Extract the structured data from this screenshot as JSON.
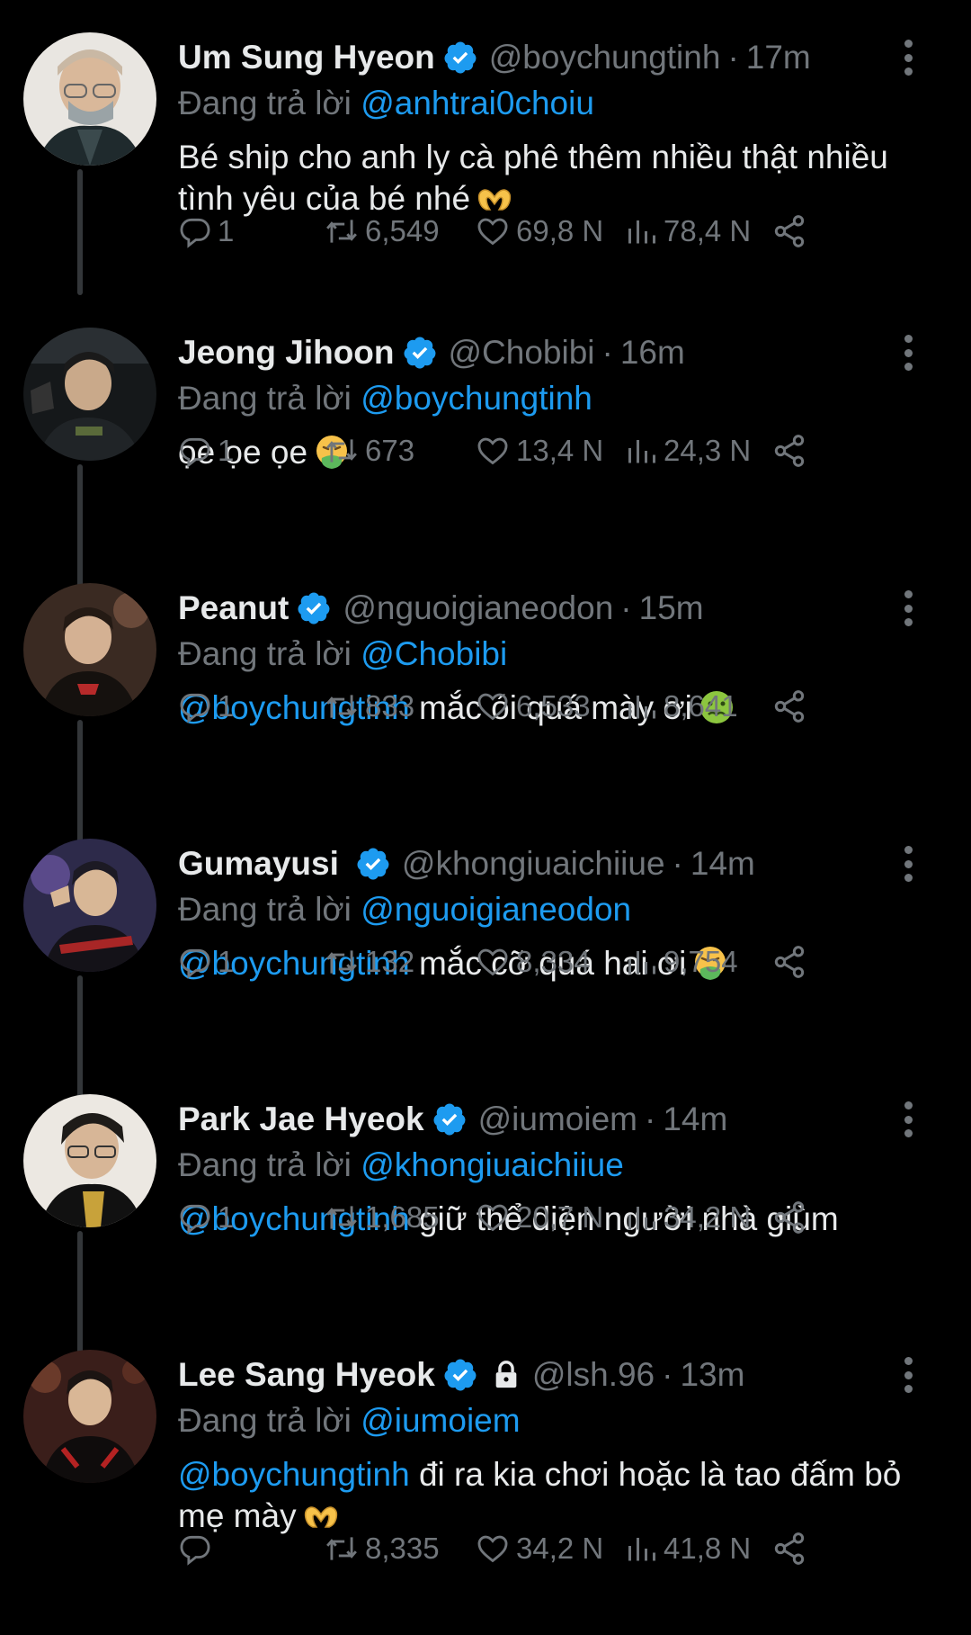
{
  "labels": {
    "replying_to": "Đang trả lời"
  },
  "colors": {
    "accent": "#1d9bf0",
    "muted": "#71767b",
    "background": "#000000"
  },
  "tweets": [
    {
      "name": "Um Sung Hyeon",
      "handle": "@boychungtinh",
      "time": "17m",
      "reply_to": "@anhtrai0choiu",
      "body_mention": "",
      "body_text": "Bé ship cho anh ly cà phê thêm nhiều thật nhiều tình yêu của bé nhé",
      "emoji": "heart-hands-emoji",
      "replies": "1",
      "retweets": "6,549",
      "likes": "69,8 N",
      "views": "78,4 N"
    },
    {
      "name": "Jeong Jihoon",
      "handle": "@Chobibi",
      "time": "16m",
      "reply_to": "@boychungtinh",
      "body_mention": "",
      "body_text": "ọe ọe ọe",
      "emoji": "vomiting-face-emoji",
      "replies": "1",
      "retweets": "673",
      "likes": "13,4 N",
      "views": "24,3 N"
    },
    {
      "name": "Peanut",
      "handle": "@nguoigianeodon",
      "time": "15m",
      "reply_to": "@Chobibi",
      "body_mention": "@boychungtinh",
      "body_text": "mắc ói quá mày ơi",
      "emoji": "nauseated-face-emoji",
      "replies": "1",
      "retweets": "833",
      "likes": "6,533",
      "views": "8,641"
    },
    {
      "name": "Gumayusi",
      "handle": "@khongiuaichiiue",
      "time": "14m",
      "reply_to": "@nguoigianeodon",
      "body_mention": "@boychungtinh",
      "body_text": "mắc cỡ quá hai ơi",
      "emoji": "vomiting-face-emoji",
      "replies": "1",
      "retweets": "132",
      "likes": "8,334",
      "views": "9,754"
    },
    {
      "name": "Park Jae Hyeok",
      "handle": "@iumoiem",
      "time": "14m",
      "reply_to": "@khongiuaichiiue",
      "body_mention": "@boychungtinh",
      "body_text": "giữ thể diện người nhà giùm",
      "emoji": "",
      "replies": "1",
      "retweets": "1,685",
      "likes": "20,7 N",
      "views": "34,2 N"
    },
    {
      "name": "Lee Sang Hyeok",
      "handle": "@lsh.96",
      "time": "13m",
      "reply_to": "@iumoiem",
      "body_mention": "@boychungtinh",
      "body_text": "đi ra kia chơi hoặc là tao đấm bỏ mẹ mày",
      "emoji": "heart-hands-emoji",
      "replies": "",
      "retweets": "8,335",
      "likes": "34,2 N",
      "views": "41,8 N"
    }
  ]
}
